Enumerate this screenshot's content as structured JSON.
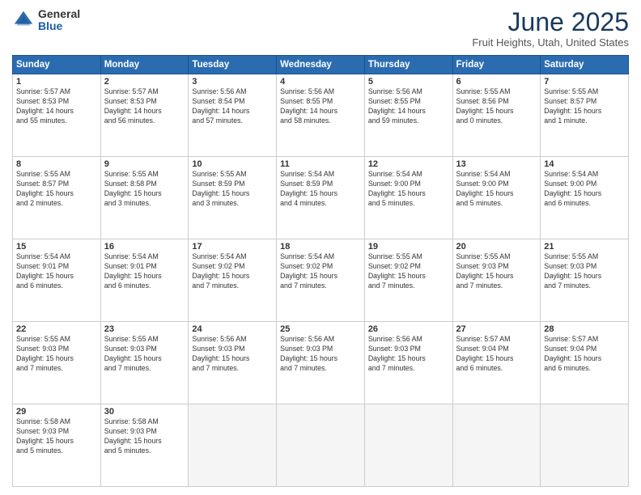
{
  "logo": {
    "general": "General",
    "blue": "Blue"
  },
  "title": "June 2025",
  "location": "Fruit Heights, Utah, United States",
  "days_header": [
    "Sunday",
    "Monday",
    "Tuesday",
    "Wednesday",
    "Thursday",
    "Friday",
    "Saturday"
  ],
  "weeks": [
    [
      {
        "day": "1",
        "lines": [
          "Sunrise: 5:57 AM",
          "Sunset: 8:53 PM",
          "Daylight: 14 hours",
          "and 55 minutes."
        ]
      },
      {
        "day": "2",
        "lines": [
          "Sunrise: 5:57 AM",
          "Sunset: 8:53 PM",
          "Daylight: 14 hours",
          "and 56 minutes."
        ]
      },
      {
        "day": "3",
        "lines": [
          "Sunrise: 5:56 AM",
          "Sunset: 8:54 PM",
          "Daylight: 14 hours",
          "and 57 minutes."
        ]
      },
      {
        "day": "4",
        "lines": [
          "Sunrise: 5:56 AM",
          "Sunset: 8:55 PM",
          "Daylight: 14 hours",
          "and 58 minutes."
        ]
      },
      {
        "day": "5",
        "lines": [
          "Sunrise: 5:56 AM",
          "Sunset: 8:55 PM",
          "Daylight: 14 hours",
          "and 59 minutes."
        ]
      },
      {
        "day": "6",
        "lines": [
          "Sunrise: 5:55 AM",
          "Sunset: 8:56 PM",
          "Daylight: 15 hours",
          "and 0 minutes."
        ]
      },
      {
        "day": "7",
        "lines": [
          "Sunrise: 5:55 AM",
          "Sunset: 8:57 PM",
          "Daylight: 15 hours",
          "and 1 minute."
        ]
      }
    ],
    [
      {
        "day": "8",
        "lines": [
          "Sunrise: 5:55 AM",
          "Sunset: 8:57 PM",
          "Daylight: 15 hours",
          "and 2 minutes."
        ]
      },
      {
        "day": "9",
        "lines": [
          "Sunrise: 5:55 AM",
          "Sunset: 8:58 PM",
          "Daylight: 15 hours",
          "and 3 minutes."
        ]
      },
      {
        "day": "10",
        "lines": [
          "Sunrise: 5:55 AM",
          "Sunset: 8:59 PM",
          "Daylight: 15 hours",
          "and 3 minutes."
        ]
      },
      {
        "day": "11",
        "lines": [
          "Sunrise: 5:54 AM",
          "Sunset: 8:59 PM",
          "Daylight: 15 hours",
          "and 4 minutes."
        ]
      },
      {
        "day": "12",
        "lines": [
          "Sunrise: 5:54 AM",
          "Sunset: 9:00 PM",
          "Daylight: 15 hours",
          "and 5 minutes."
        ]
      },
      {
        "day": "13",
        "lines": [
          "Sunrise: 5:54 AM",
          "Sunset: 9:00 PM",
          "Daylight: 15 hours",
          "and 5 minutes."
        ]
      },
      {
        "day": "14",
        "lines": [
          "Sunrise: 5:54 AM",
          "Sunset: 9:00 PM",
          "Daylight: 15 hours",
          "and 6 minutes."
        ]
      }
    ],
    [
      {
        "day": "15",
        "lines": [
          "Sunrise: 5:54 AM",
          "Sunset: 9:01 PM",
          "Daylight: 15 hours",
          "and 6 minutes."
        ]
      },
      {
        "day": "16",
        "lines": [
          "Sunrise: 5:54 AM",
          "Sunset: 9:01 PM",
          "Daylight: 15 hours",
          "and 6 minutes."
        ]
      },
      {
        "day": "17",
        "lines": [
          "Sunrise: 5:54 AM",
          "Sunset: 9:02 PM",
          "Daylight: 15 hours",
          "and 7 minutes."
        ]
      },
      {
        "day": "18",
        "lines": [
          "Sunrise: 5:54 AM",
          "Sunset: 9:02 PM",
          "Daylight: 15 hours",
          "and 7 minutes."
        ]
      },
      {
        "day": "19",
        "lines": [
          "Sunrise: 5:55 AM",
          "Sunset: 9:02 PM",
          "Daylight: 15 hours",
          "and 7 minutes."
        ]
      },
      {
        "day": "20",
        "lines": [
          "Sunrise: 5:55 AM",
          "Sunset: 9:03 PM",
          "Daylight: 15 hours",
          "and 7 minutes."
        ]
      },
      {
        "day": "21",
        "lines": [
          "Sunrise: 5:55 AM",
          "Sunset: 9:03 PM",
          "Daylight: 15 hours",
          "and 7 minutes."
        ]
      }
    ],
    [
      {
        "day": "22",
        "lines": [
          "Sunrise: 5:55 AM",
          "Sunset: 9:03 PM",
          "Daylight: 15 hours",
          "and 7 minutes."
        ]
      },
      {
        "day": "23",
        "lines": [
          "Sunrise: 5:55 AM",
          "Sunset: 9:03 PM",
          "Daylight: 15 hours",
          "and 7 minutes."
        ]
      },
      {
        "day": "24",
        "lines": [
          "Sunrise: 5:56 AM",
          "Sunset: 9:03 PM",
          "Daylight: 15 hours",
          "and 7 minutes."
        ]
      },
      {
        "day": "25",
        "lines": [
          "Sunrise: 5:56 AM",
          "Sunset: 9:03 PM",
          "Daylight: 15 hours",
          "and 7 minutes."
        ]
      },
      {
        "day": "26",
        "lines": [
          "Sunrise: 5:56 AM",
          "Sunset: 9:03 PM",
          "Daylight: 15 hours",
          "and 7 minutes."
        ]
      },
      {
        "day": "27",
        "lines": [
          "Sunrise: 5:57 AM",
          "Sunset: 9:04 PM",
          "Daylight: 15 hours",
          "and 6 minutes."
        ]
      },
      {
        "day": "28",
        "lines": [
          "Sunrise: 5:57 AM",
          "Sunset: 9:04 PM",
          "Daylight: 15 hours",
          "and 6 minutes."
        ]
      }
    ],
    [
      {
        "day": "29",
        "lines": [
          "Sunrise: 5:58 AM",
          "Sunset: 9:03 PM",
          "Daylight: 15 hours",
          "and 5 minutes."
        ]
      },
      {
        "day": "30",
        "lines": [
          "Sunrise: 5:58 AM",
          "Sunset: 9:03 PM",
          "Daylight: 15 hours",
          "and 5 minutes."
        ]
      },
      {
        "day": "",
        "lines": []
      },
      {
        "day": "",
        "lines": []
      },
      {
        "day": "",
        "lines": []
      },
      {
        "day": "",
        "lines": []
      },
      {
        "day": "",
        "lines": []
      }
    ]
  ]
}
